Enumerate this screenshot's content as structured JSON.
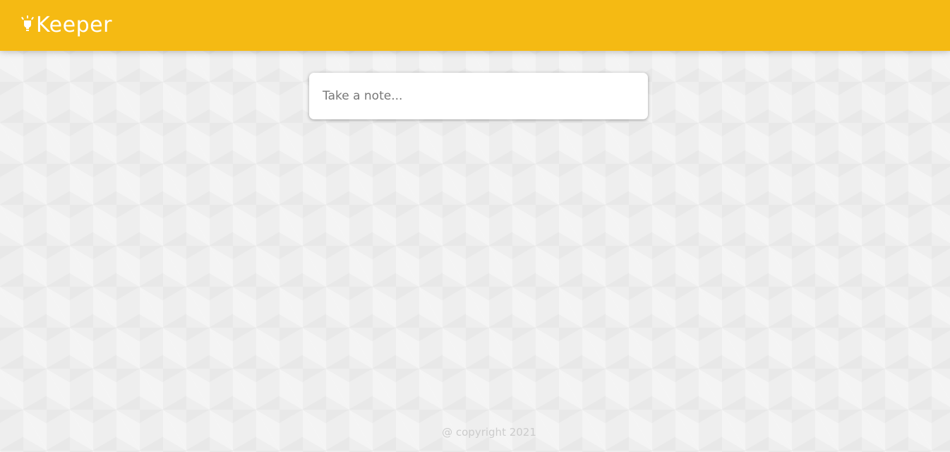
{
  "header": {
    "brand_title": "Keeper",
    "brand_icon": "lightbulb-icon",
    "background_color": "#f5ba13",
    "text_color": "#ffffff"
  },
  "note_form": {
    "placeholder": "Take a note...",
    "value": ""
  },
  "footer": {
    "copyright": "@ copyright 2021"
  }
}
